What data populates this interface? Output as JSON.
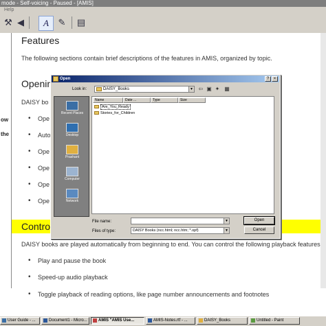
{
  "app": {
    "title": "mode - Self-voicing - Paused - [AMIS]",
    "menu_help": "Help"
  },
  "side_pane": {
    "frag1": "ow",
    "frag2": "the"
  },
  "document": {
    "heading_features": "Features",
    "features_intro": "The following sections contain brief descriptions of the features in AMIS, organized by topic.",
    "heading_opening": "Openin",
    "daisy_frag": "DAISY bo",
    "open_bullets": [
      "Ope",
      "Auto",
      "Ope",
      "Ope",
      "Ope",
      "Ope"
    ],
    "heading_control": "Control",
    "control_intro": "DAISY books are played automatically from beginning to end. You can control the following playback features:",
    "control_bullets": [
      "Play and pause the book",
      "Speed-up audio playback",
      "Toggle playback of reading options, like page number announcements and footnotes"
    ]
  },
  "dialog": {
    "title": "Open",
    "look_in_label": "Look in:",
    "look_in_value": "DAISY_Books",
    "columns": [
      "Name",
      "Date ...",
      "Type",
      "Size"
    ],
    "files": [
      "Are_You_Ready",
      "Stories_for_Children"
    ],
    "places": [
      "Recent Places",
      "Desktop",
      "Prashant",
      "Computer",
      "Network"
    ],
    "file_name_label": "File name:",
    "file_name_value": "",
    "files_of_type_label": "Files of type:",
    "files_of_type_value": "DAISY Books (ncc.html; ncc.htm; *.opf)",
    "open_button": "Open",
    "cancel_button": "Cancel"
  },
  "taskbar": {
    "tasks": [
      "User Guide - ...",
      "Document1 - Micro...",
      "AMIS \"AMIS Use...",
      "AMIS-Notes.rtf - ...",
      "DAISY_Books",
      "Untitled - Paint"
    ]
  },
  "colors": {
    "highlight": "#ffff00",
    "dialog_title": "#0a246a",
    "chrome": "#d4d0c8"
  }
}
